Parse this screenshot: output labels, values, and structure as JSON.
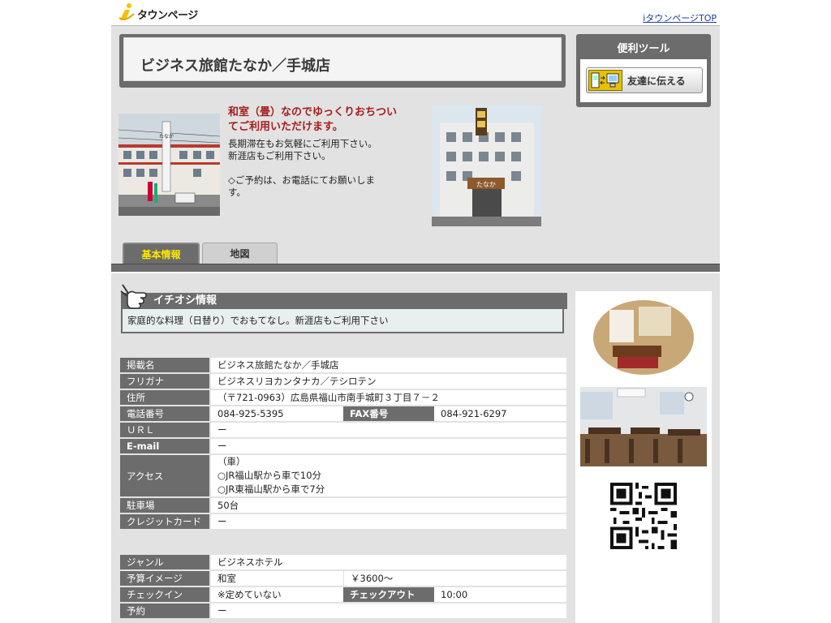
{
  "header": {
    "logo_text": "タウンページ",
    "top_link": "iタウンページTOP"
  },
  "shop": {
    "title": "ビジネス旅館たなか／手城店",
    "catch_copy": "和室（畳）なのでゆっくりおちついてご利用いただけます。",
    "desc_lines": [
      "長期滞在もお気軽にご利用下さい。",
      "新涯店もご利用下さい。",
      "",
      "◇ご予約は、お電話にてお願いします。"
    ],
    "photo1_sign": "たなか",
    "photo2_sign": "たなか"
  },
  "tools": {
    "title": "便利ツール",
    "share_button": "友達に伝える"
  },
  "tabs": {
    "basic": "基本情報",
    "map": "地図"
  },
  "recommend": {
    "title": "イチオシ情報",
    "text": "家庭的な料理（日替り）でおもてなし。新涯店もご利用下さい"
  },
  "info": {
    "name_label": "掲載名",
    "name_value": "ビジネス旅館たなか／手城店",
    "kana_label": "フリガナ",
    "kana_value": "ビジネスリヨカンタナカ／テシロテン",
    "address_label": "住所",
    "address_value": "（〒721-0963）広島県福山市南手城町３丁目７－２",
    "tel_label": "電話番号",
    "tel_value": "084-925-5395",
    "fax_label": "FAX番号",
    "fax_value": "084-921-6297",
    "url_label": "ＵＲＬ",
    "url_value": "ー",
    "email_label": "E-mail",
    "email_value": "ー",
    "access_label": "アクセス",
    "access_lines": [
      "（車）",
      "○JR福山駅から車で10分",
      "○JR東福山駅から車で7分"
    ],
    "parking_label": "駐車場",
    "parking_value": "50台",
    "credit_label": "クレジットカード",
    "credit_value": "ー"
  },
  "detail": {
    "genre_label": "ジャンル",
    "genre_value": "ビジネスホテル",
    "budget_label": "予算イメージ",
    "budget_type": "和室",
    "budget_value": "￥3600～",
    "checkin_label": "チェックイン",
    "checkin_value": "※定めていない",
    "checkout_label": "チェックアウト",
    "checkout_value": "10:00",
    "reserve_label": "予約",
    "reserve_value": "ー"
  }
}
